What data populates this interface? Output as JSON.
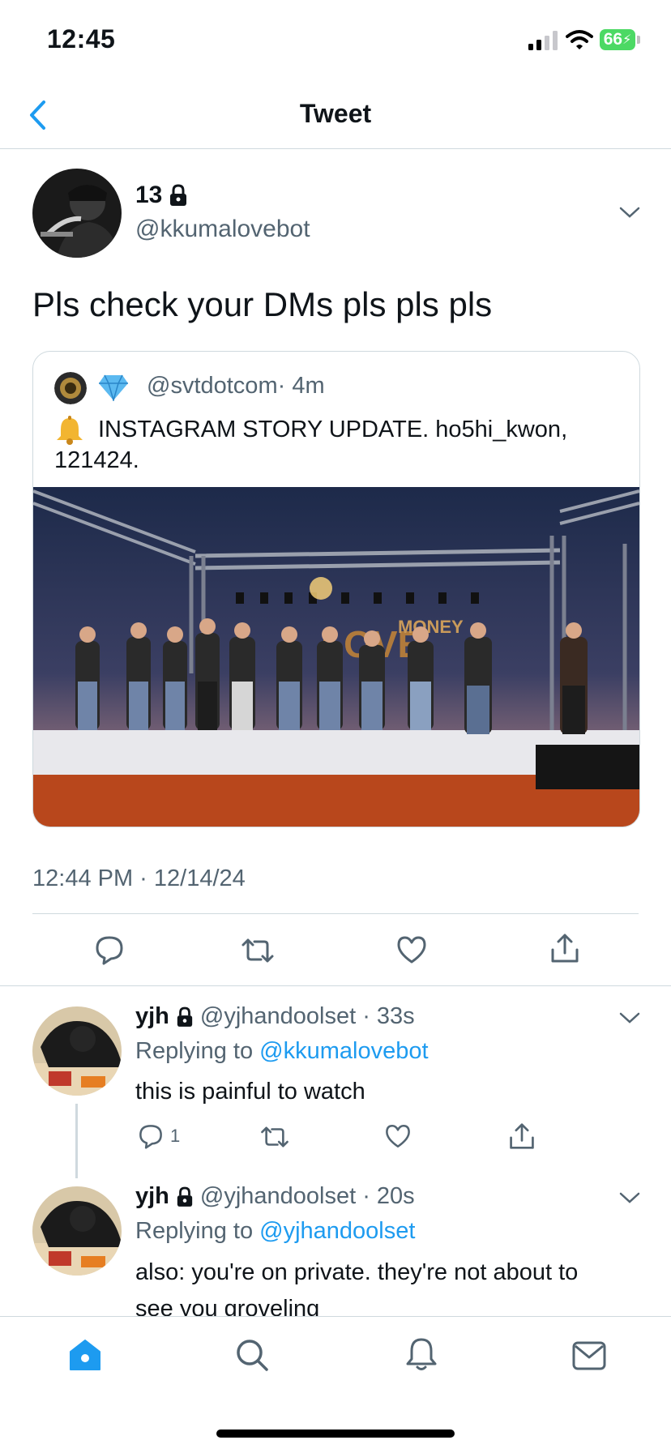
{
  "status_bar": {
    "time": "12:45",
    "battery": "66"
  },
  "header": {
    "title": "Tweet"
  },
  "tweet": {
    "display_name": "13",
    "handle": "@kkumalovebot",
    "text": "Pls check your DMs pls pls pls",
    "timestamp": "12:44 PM · 12/14/24",
    "quote": {
      "handle": "@svtdotcom",
      "age": "· 4m",
      "text_line1": "INSTAGRAM STORY UPDATE. ho5hi_kwon,",
      "text_line2": "121424."
    }
  },
  "replies": [
    {
      "display_name": "yjh",
      "handle": "@yjhandoolset",
      "age": "· 33s",
      "replying_prefix": "Replying to ",
      "replying_to": "@kkumalovebot",
      "text": "this is painful to watch",
      "reply_count": "1"
    },
    {
      "display_name": "yjh",
      "handle": "@yjhandoolset",
      "age": "· 20s",
      "replying_prefix": "Replying to ",
      "replying_to": "@yjhandoolset",
      "text_line1": "also: you're on private. they're not about to",
      "text_line2": "see you groveling"
    }
  ],
  "colors": {
    "accent": "#1d9bf0",
    "muted": "#536471",
    "border": "#cfd9de",
    "icon": "#536471"
  },
  "icons": [
    "back-chevron-icon",
    "lock-icon",
    "chevron-down-icon",
    "reply-icon",
    "retweet-icon",
    "like-icon",
    "share-icon",
    "home-icon",
    "search-icon",
    "notifications-icon",
    "messages-icon",
    "bell-emoji-icon",
    "gem-emoji-icon",
    "wifi-icon",
    "signal-icon"
  ]
}
